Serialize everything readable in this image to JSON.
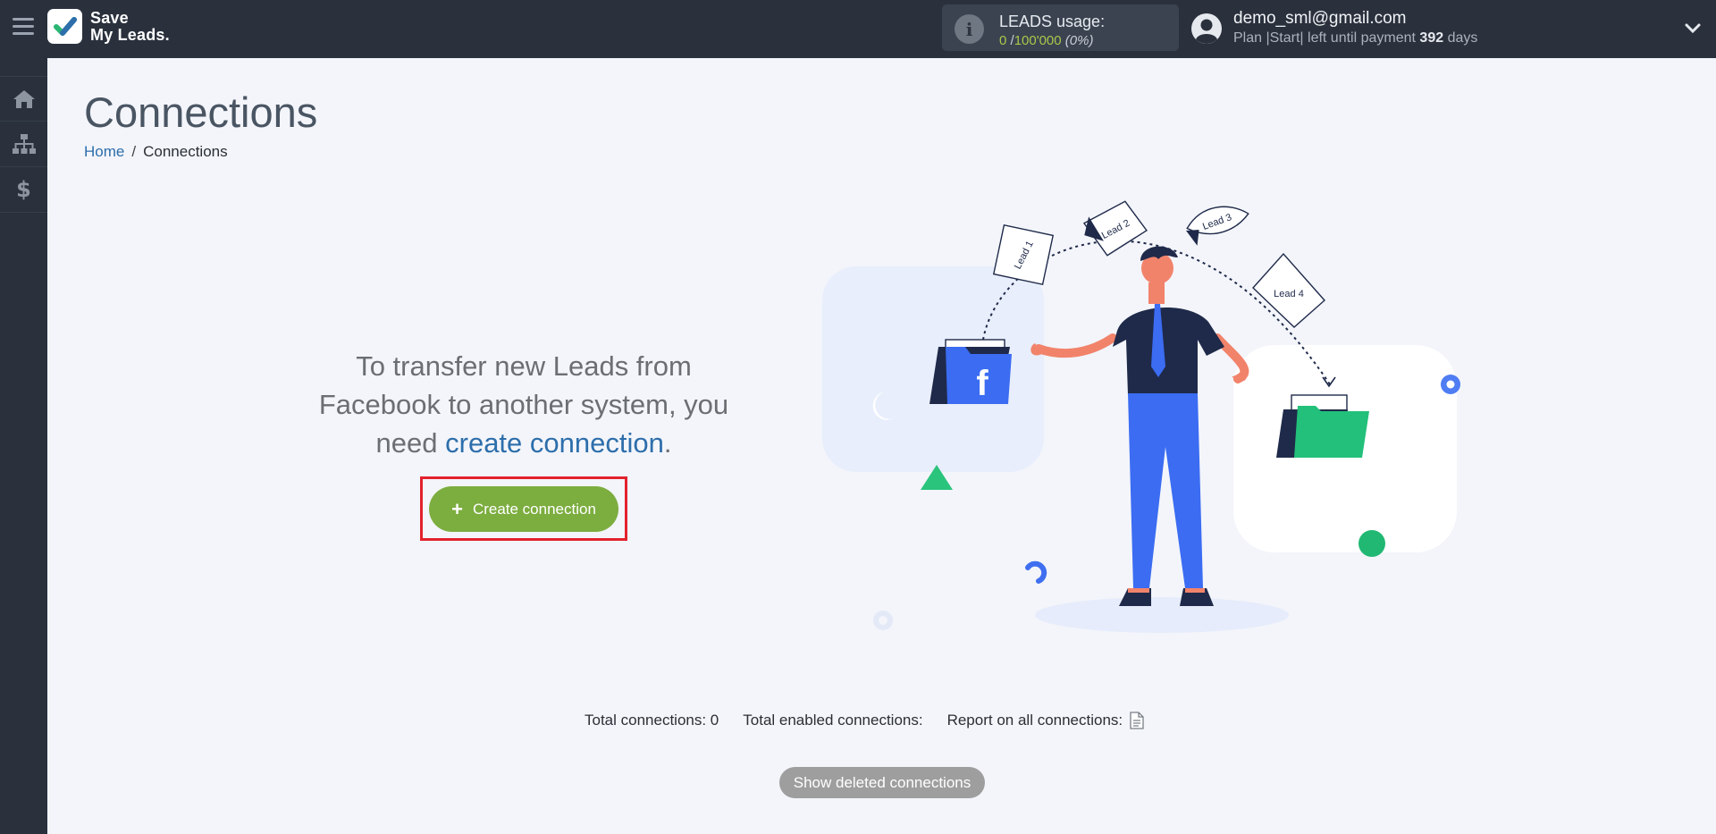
{
  "app": {
    "logo_line1": "Save",
    "logo_line2": "My Leads.",
    "accent": "#7cad3f",
    "link": "#2d6eab"
  },
  "usage": {
    "title": "LEADS usage:",
    "used": "0",
    "limit": "100'000",
    "percent": "(0%)"
  },
  "user": {
    "email": "demo_sml@gmail.com",
    "plan_text": "Plan |Start| left until payment",
    "days": "392",
    "days_suffix": "days"
  },
  "sidebar": {
    "items": [
      {
        "icon": "home-icon"
      },
      {
        "icon": "sitemap-icon"
      },
      {
        "icon": "dollar-icon",
        "glyph": "$"
      }
    ]
  },
  "page": {
    "title": "Connections"
  },
  "breadcrumb": {
    "home": "Home",
    "separator": "/",
    "current": "Connections"
  },
  "prompt": {
    "line1": "To transfer new Leads from",
    "line2": "Facebook to another system, you",
    "line3_start": "need",
    "link": "create connection",
    "line3_end": "."
  },
  "cta": {
    "plus": "+",
    "label": "Create connection"
  },
  "illustration": {
    "leads": [
      "Lead 1",
      "Lead 2",
      "Lead 3",
      "Lead 4"
    ],
    "source_letter": "f"
  },
  "stats": {
    "total": "Total connections: 0",
    "enabled": "Total enabled connections:",
    "report": "Report on all connections:"
  },
  "footer": {
    "show_deleted": "Show deleted connections"
  }
}
